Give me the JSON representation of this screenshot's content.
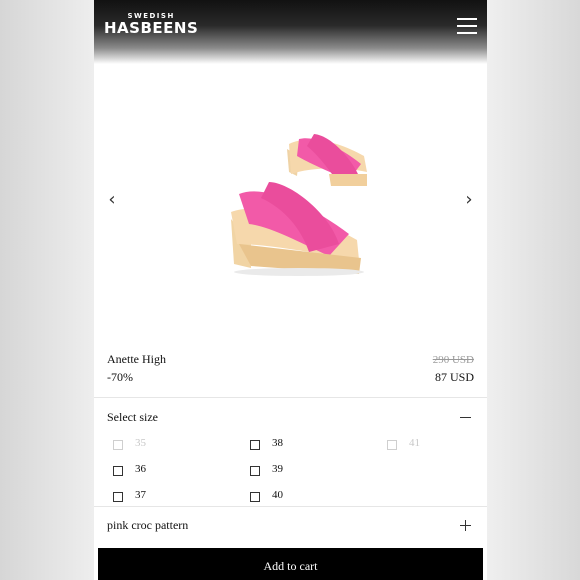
{
  "header": {
    "logo_small": "SWEDISH",
    "logo_main": "HASBEENS",
    "menu_icon": "hamburger-menu-icon"
  },
  "gallery": {
    "prev_icon": "chevron-left-icon",
    "next_icon": "chevron-right-icon"
  },
  "product": {
    "name": "Anette High",
    "discount": "-70%",
    "original_price": "290 USD",
    "sale_price": "87 USD",
    "shoe_color": "#f25aa8"
  },
  "sizes": {
    "title": "Select size",
    "collapse_icon": "minus-icon",
    "options": [
      {
        "label": "35",
        "available": false
      },
      {
        "label": "36",
        "available": true
      },
      {
        "label": "37",
        "available": true
      },
      {
        "label": "38",
        "available": true
      },
      {
        "label": "39",
        "available": true
      },
      {
        "label": "40",
        "available": true
      },
      {
        "label": "41",
        "available": false
      }
    ]
  },
  "color": {
    "label": "pink croc pattern",
    "expand_icon": "plus-icon"
  },
  "cart": {
    "button_label": "Add to cart"
  }
}
